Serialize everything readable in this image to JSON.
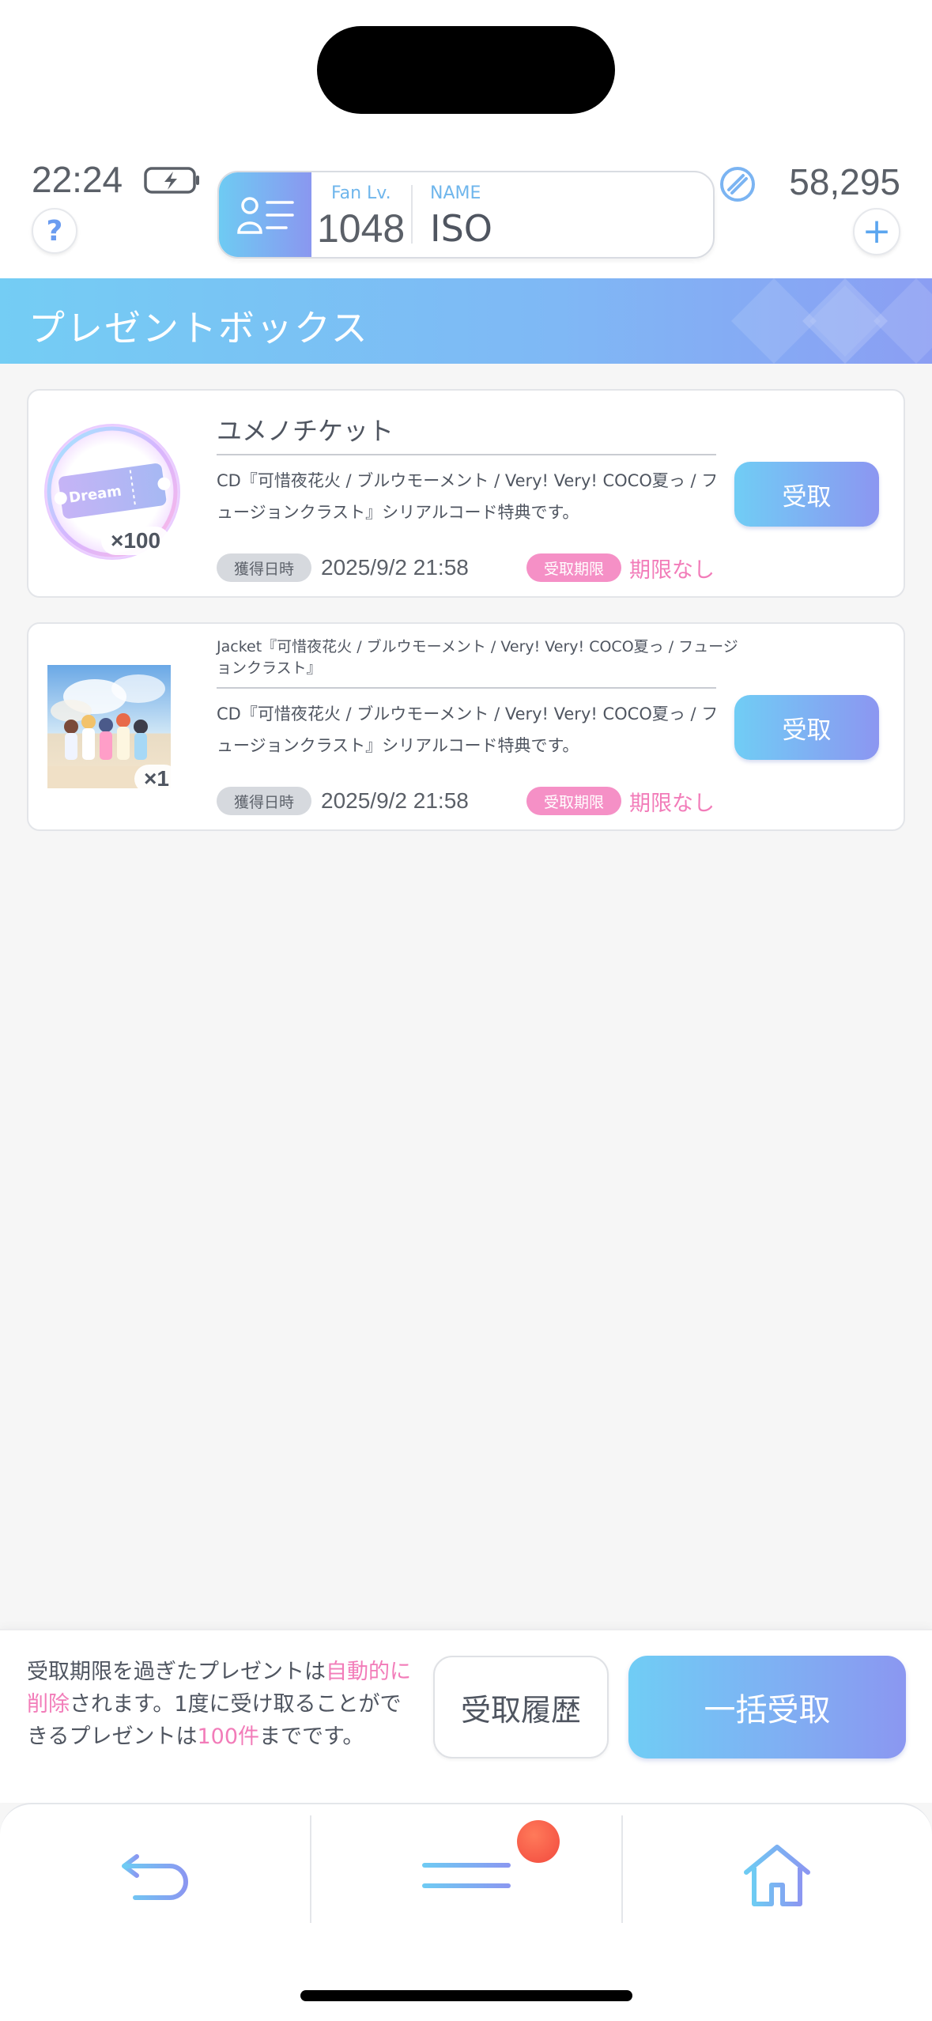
{
  "status_bar": {
    "time": "22:24",
    "currency_amount": "58,295"
  },
  "profile": {
    "fan_lv_label": "Fan Lv.",
    "fan_lv_value": "1048",
    "name_label": "NAME",
    "name_value": "ISO"
  },
  "header": {
    "title": "プレゼントボックス"
  },
  "presents": [
    {
      "name": "ユメノチケット",
      "description": "CD『可惜夜花火 / ブルウモーメント / Very! Very! COCO夏っ / フュージョンクラスト』シリアルコード特典です。",
      "quantity": "×100",
      "thumb_text": "Dream",
      "acquired_label": "獲得日時",
      "acquired_date": "2025/9/2 21:58",
      "deadline_label": "受取期限",
      "deadline_value": "期限なし",
      "button_label": "受取"
    },
    {
      "name": "Jacket『可惜夜花火 / ブルウモーメント / Very! Very! COCO夏っ / フュージョンクラスト』",
      "description": "CD『可惜夜花火 / ブルウモーメント / Very! Very! COCO夏っ / フュージョンクラスト』シリアルコード特典です。",
      "quantity": "×1",
      "acquired_label": "獲得日時",
      "acquired_date": "2025/9/2 21:58",
      "deadline_label": "受取期限",
      "deadline_value": "期限なし",
      "button_label": "受取"
    }
  ],
  "footer": {
    "notice_part1": "受取期限を過ぎたプレゼントは",
    "notice_highlight1": "自動的に削除",
    "notice_part2": "されます。1度に受け取ることができるプレゼントは",
    "notice_highlight2": "100件",
    "notice_part3": "までです。",
    "history_button": "受取履歴",
    "bulk_button": "一括受取"
  },
  "nav": {
    "icons": [
      "back-icon",
      "menu-icon",
      "home-icon"
    ]
  },
  "colors": {
    "accent_blue": "#70cdf5",
    "accent_purple": "#8b97f1",
    "highlight_pink": "#f27cb9"
  }
}
